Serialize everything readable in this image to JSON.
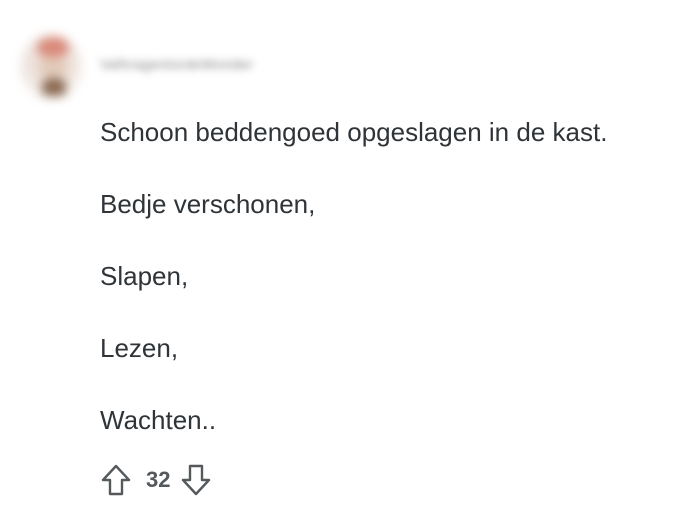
{
  "comment": {
    "username": "ValhragentordeWonder",
    "lines": [
      "Schoon beddengoed opgeslagen in de kast.",
      "Bedje verschonen,",
      "Slapen,",
      "Lezen,",
      "Wachten.."
    ],
    "votes": "32"
  },
  "icons": {
    "upvote": "arrow-up-outline-icon",
    "downvote": "arrow-down-outline-icon"
  },
  "colors": {
    "text": "#2f3438",
    "icon": "#55595c",
    "background": "#ffffff"
  }
}
